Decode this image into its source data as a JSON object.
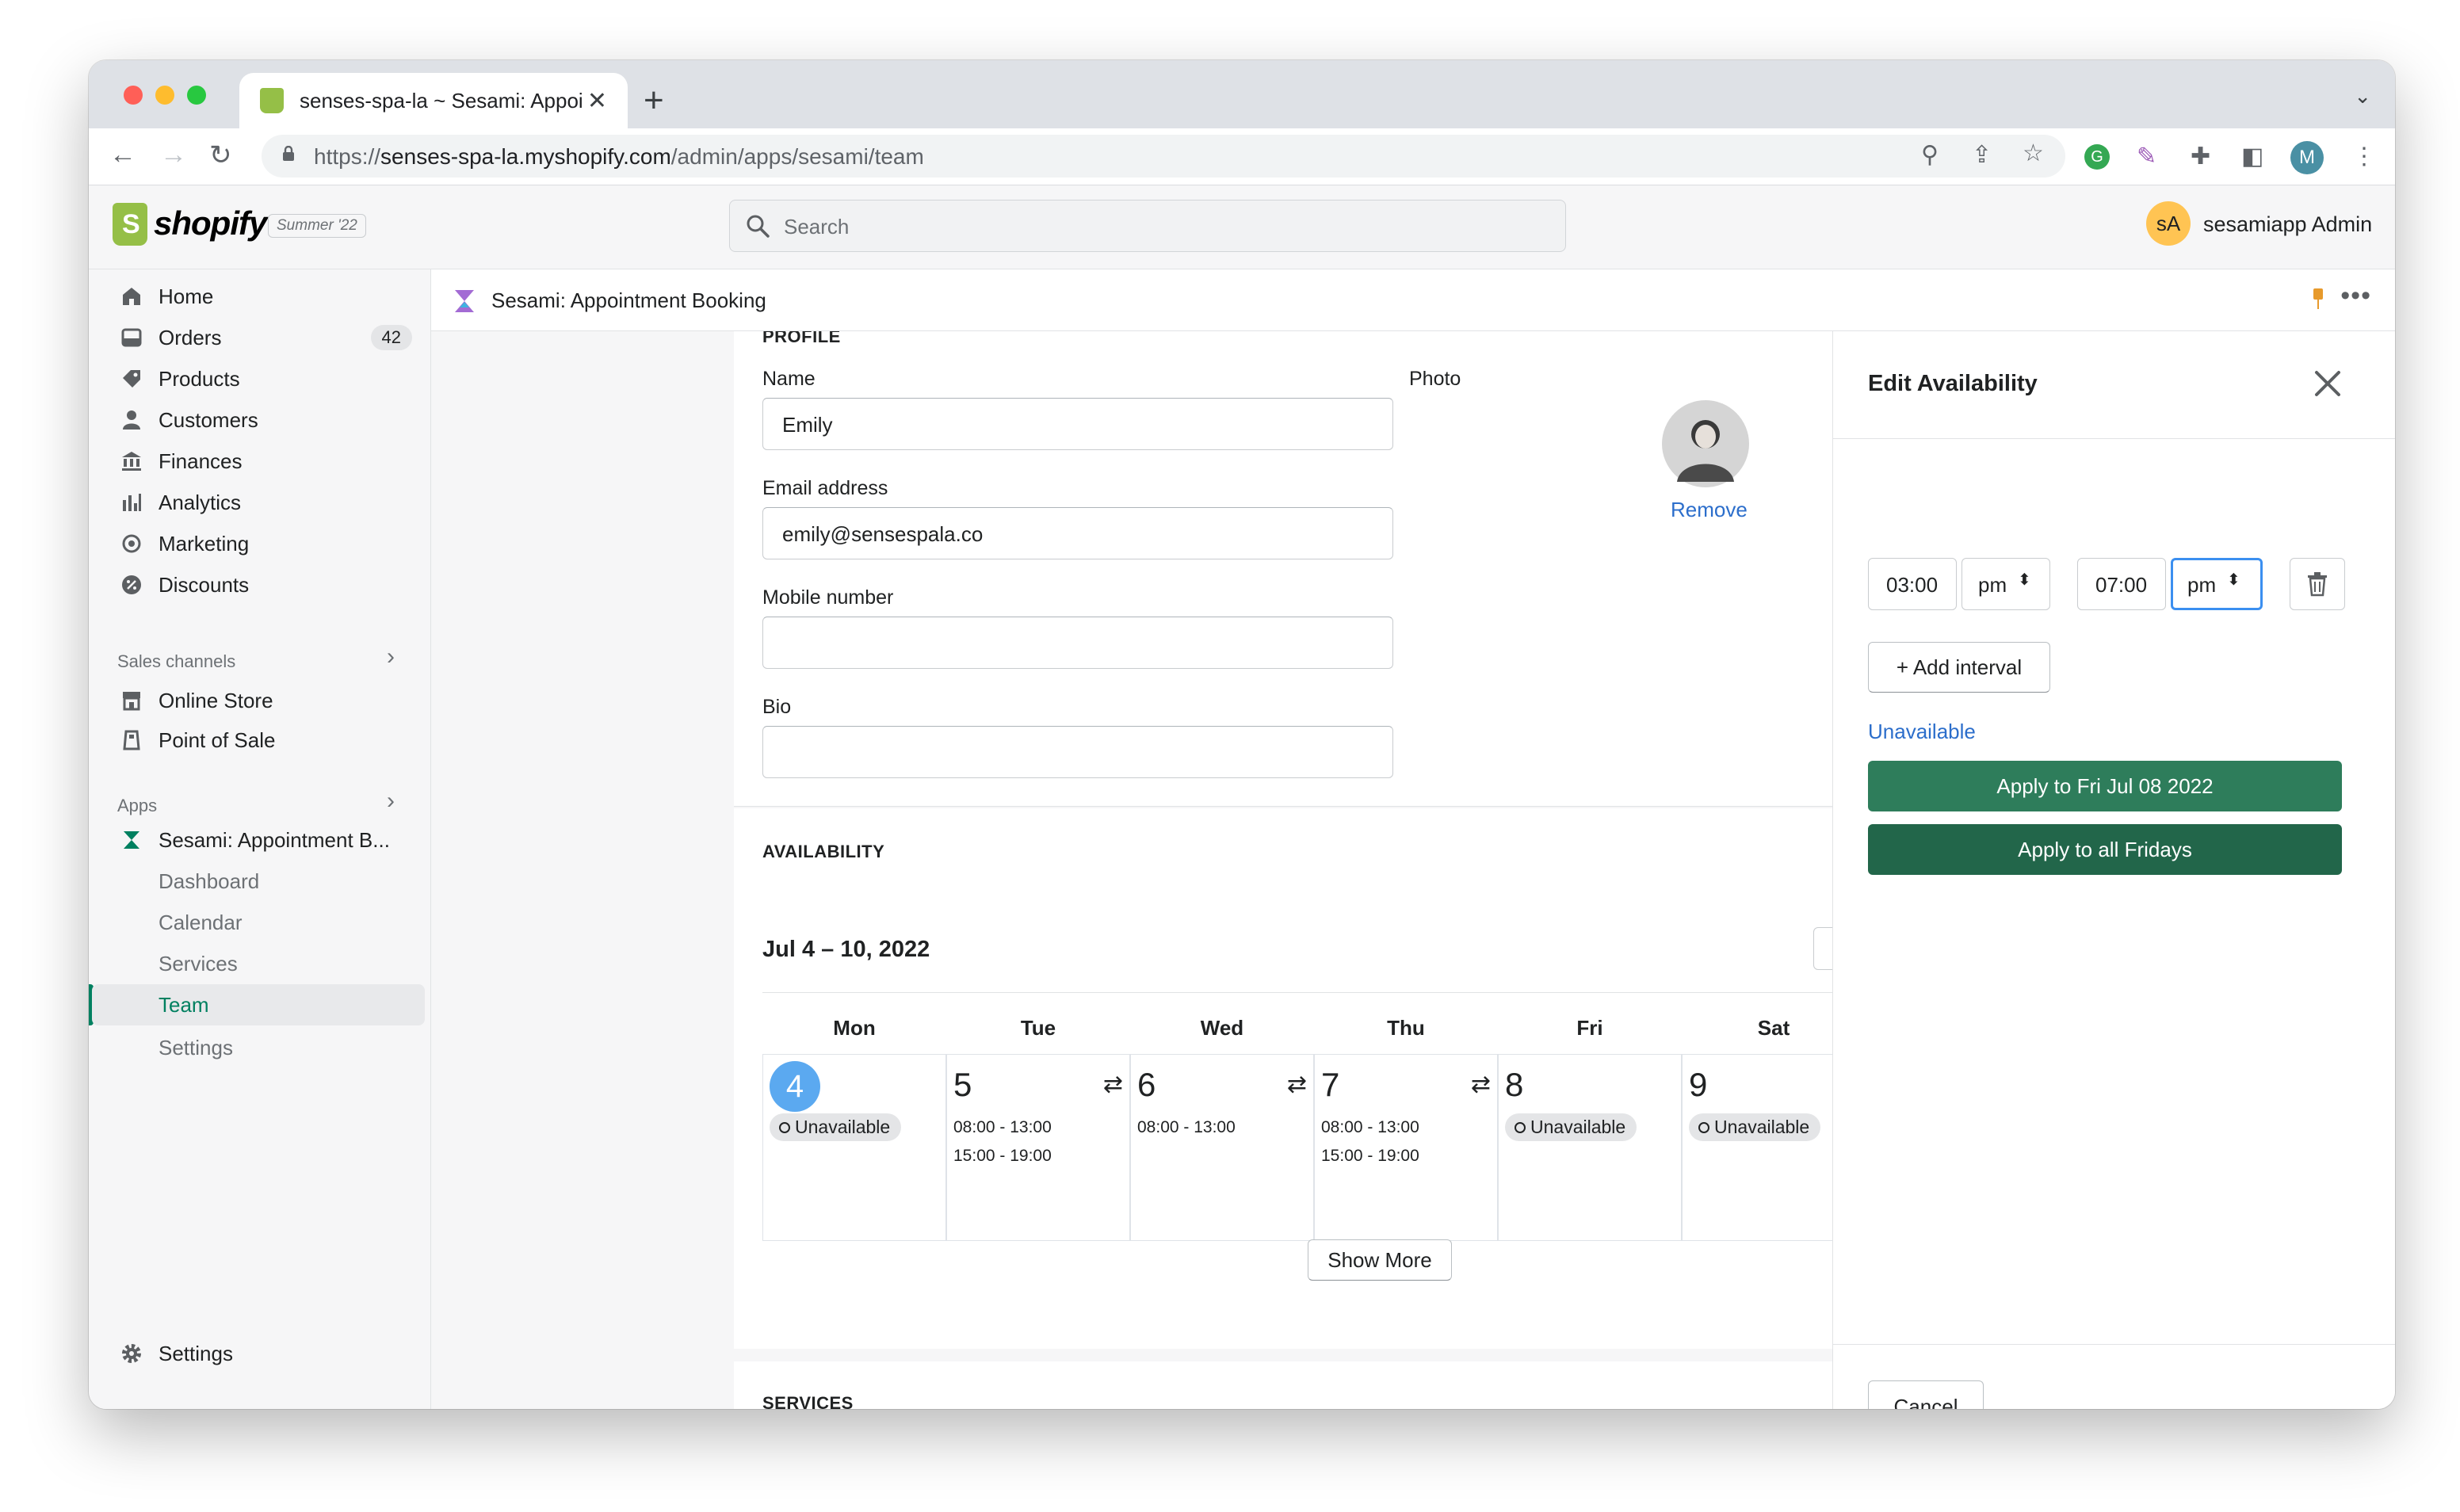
{
  "browser": {
    "tab_title": "senses-spa-la ~ Sesami: Appoi",
    "url_prefix": "https://",
    "url_host": "senses-spa-la.myshopify.com",
    "url_path": "/admin/apps/sesami/team",
    "profile_initial": "M"
  },
  "shopify": {
    "logo_text": "shopify",
    "edition": "Summer '22",
    "search_placeholder": "Search",
    "avatar_initials": "sA",
    "account_name": "sesamiapp Admin"
  },
  "sidebar": {
    "items": [
      {
        "label": "Home",
        "icon": "home-icon"
      },
      {
        "label": "Orders",
        "icon": "orders-icon",
        "badge": "42"
      },
      {
        "label": "Products",
        "icon": "tag-icon"
      },
      {
        "label": "Customers",
        "icon": "person-icon"
      },
      {
        "label": "Finances",
        "icon": "bank-icon"
      },
      {
        "label": "Analytics",
        "icon": "bar-chart-icon"
      },
      {
        "label": "Marketing",
        "icon": "target-icon"
      },
      {
        "label": "Discounts",
        "icon": "discount-icon"
      }
    ],
    "sales_channels_heading": "Sales channels",
    "sales_channels": [
      {
        "label": "Online Store",
        "icon": "store-icon"
      },
      {
        "label": "Point of Sale",
        "icon": "pos-icon"
      }
    ],
    "apps_heading": "Apps",
    "app_name": "Sesami: Appointment B...",
    "app_subitems": [
      "Dashboard",
      "Calendar",
      "Services",
      "Team",
      "Settings"
    ],
    "active_subitem": "Team",
    "settings_label": "Settings"
  },
  "appbar": {
    "title": "Sesami: Appointment Booking"
  },
  "profile": {
    "section_title": "PROFILE",
    "name_label": "Name",
    "name_value": "Emily",
    "email_label": "Email address",
    "email_value": "emily@sensespala.co",
    "mobile_label": "Mobile number",
    "mobile_value": "",
    "bio_label": "Bio",
    "bio_value": "",
    "photo_label": "Photo",
    "remove_label": "Remove"
  },
  "availability": {
    "section_title": "AVAILABILITY",
    "week_range": "Jul 4 – 10, 2022",
    "days": [
      {
        "name": "Mon",
        "num": "4",
        "today": true,
        "status": "Unavailable",
        "slots": []
      },
      {
        "name": "Tue",
        "num": "5",
        "repeat": true,
        "slots": [
          "08:00 - 13:00",
          "15:00 - 19:00"
        ]
      },
      {
        "name": "Wed",
        "num": "6",
        "repeat": true,
        "slots": [
          "08:00 - 13:00"
        ]
      },
      {
        "name": "Thu",
        "num": "7",
        "repeat": true,
        "slots": [
          "08:00 - 13:00",
          "15:00 - 19:00"
        ]
      },
      {
        "name": "Fri",
        "num": "8",
        "status": "Unavailable",
        "slots": []
      },
      {
        "name": "Sat",
        "num": "9",
        "status": "Unavailable",
        "slots": []
      }
    ],
    "show_more_label": "Show More",
    "services_title": "SERVICES"
  },
  "edit_panel": {
    "title": "Edit Availability",
    "start_time": "03:00",
    "start_period": "pm",
    "end_time": "07:00",
    "end_period": "pm",
    "add_interval_label": "+ Add interval",
    "unavailable_label": "Unavailable",
    "apply_date_label": "Apply to Fri Jul 08 2022",
    "apply_all_label": "Apply to all Fridays",
    "cancel_label": "Cancel"
  },
  "colors": {
    "primary_green": "#2e7d5b",
    "primary_green_dark": "#22664a",
    "accent_blue": "#5ba9f0",
    "link_blue": "#2c6ecb",
    "shopify_green": "#95bf47"
  }
}
